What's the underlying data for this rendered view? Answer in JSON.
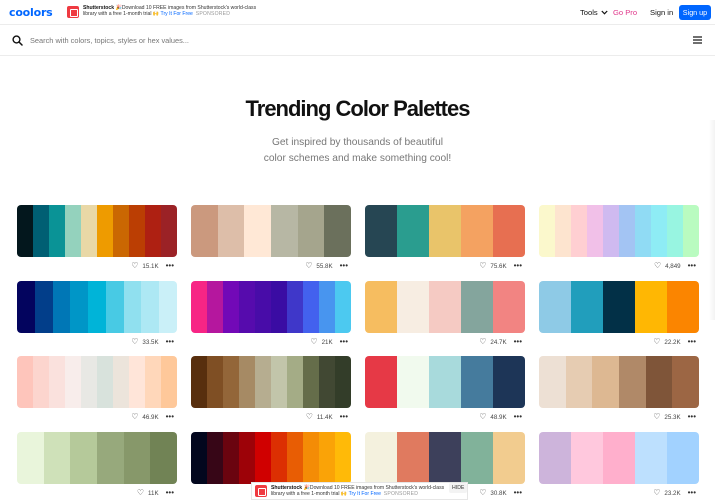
{
  "brand": {
    "logo_text": "coolors"
  },
  "ad": {
    "title": "Shutterstock",
    "body": " 🎉Download 10 FREE images from Shutterstock's world-class library with a free 1-month trial 🙌 ",
    "link": "Try It For Free",
    "sponsored": "SPONSORED",
    "hide": "HIDE"
  },
  "nav": {
    "tools": "Tools",
    "gopro": "Go Pro",
    "signin": "Sign in",
    "signup": "Sign up"
  },
  "search": {
    "placeholder": "Search with colors, topics, styles or hex values..."
  },
  "hero": {
    "title": "Trending Color Palettes",
    "subtitle_line1": "Get inspired by thousands of beautiful",
    "subtitle_line2": "color schemes and make something cool!"
  },
  "palettes": [
    {
      "likes": "15.1K",
      "colors": [
        "#03171d",
        "#005f73",
        "#0a9396",
        "#94d2bd",
        "#e9d8a6",
        "#ee9b00",
        "#ca6702",
        "#bb3e03",
        "#ae2012",
        "#9b2226"
      ]
    },
    {
      "likes": "55.8K",
      "colors": [
        "#cb997e",
        "#ddbea9",
        "#ffe8d6",
        "#b7b7a4",
        "#a5a58d",
        "#6b705c"
      ]
    },
    {
      "likes": "75.6K",
      "colors": [
        "#264653",
        "#2a9d8f",
        "#e9c46a",
        "#f4a261",
        "#e76f51"
      ]
    },
    {
      "likes": "4,849",
      "colors": [
        "#fbf8cc",
        "#fde4cf",
        "#ffcfd2",
        "#f1c0e8",
        "#cfbaf0",
        "#a3c4f3",
        "#90dbf4",
        "#8eecf5",
        "#98f5e1",
        "#b9fbc0"
      ]
    },
    {
      "likes": "33.5K",
      "colors": [
        "#03045e",
        "#023e8a",
        "#0077b6",
        "#0096c7",
        "#00b4d8",
        "#48cae4",
        "#90e0ef",
        "#ade8f4",
        "#caf0f8"
      ]
    },
    {
      "likes": "21K",
      "colors": [
        "#f72585",
        "#b5179e",
        "#7209b7",
        "#560bad",
        "#480ca8",
        "#3a0ca3",
        "#3f37c9",
        "#4361ee",
        "#4895ef",
        "#4cc9f0"
      ]
    },
    {
      "likes": "24.7K",
      "colors": [
        "#f6bd60",
        "#f7ede2",
        "#f5cac3",
        "#84a59d",
        "#f28482"
      ]
    },
    {
      "likes": "22.2K",
      "colors": [
        "#8ecae6",
        "#219ebc",
        "#023047",
        "#ffb703",
        "#fb8500"
      ]
    },
    {
      "likes": "46.9K",
      "colors": [
        "#fec5bb",
        "#fcd5ce",
        "#fae1dd",
        "#f8edeb",
        "#e8e8e4",
        "#d8e2dc",
        "#ece4db",
        "#ffe5d9",
        "#ffd7ba",
        "#fec89a"
      ]
    },
    {
      "likes": "11.4K",
      "colors": [
        "#582f0e",
        "#7f4f24",
        "#936639",
        "#a68a64",
        "#b6ad90",
        "#c2c5aa",
        "#a4ac86",
        "#656d4a",
        "#414833",
        "#333d29"
      ]
    },
    {
      "likes": "48.9K",
      "colors": [
        "#e63946",
        "#f1faee",
        "#a8dadc",
        "#457b9d",
        "#1d3557"
      ]
    },
    {
      "likes": "25.3K",
      "colors": [
        "#ede0d4",
        "#e6ccb2",
        "#ddb892",
        "#b08968",
        "#7f5539",
        "#9c6644"
      ]
    },
    {
      "likes": "11K",
      "colors": [
        "#e9f5db",
        "#cfe1b9",
        "#b5c99a",
        "#97a97c",
        "#87986a",
        "#718355"
      ]
    },
    {
      "likes": "",
      "colors": [
        "#03071e",
        "#370617",
        "#6a040f",
        "#9d0208",
        "#d00000",
        "#dc2f02",
        "#e85d04",
        "#f48c06",
        "#faa307",
        "#ffba08"
      ]
    },
    {
      "likes": "30.8K",
      "colors": [
        "#f4f1de",
        "#e07a5f",
        "#3d405b",
        "#81b29a",
        "#f2cc8f"
      ]
    },
    {
      "likes": "23.2K",
      "colors": [
        "#cdb4db",
        "#ffc8dd",
        "#ffafcc",
        "#bde0fe",
        "#a2d2ff"
      ]
    }
  ]
}
